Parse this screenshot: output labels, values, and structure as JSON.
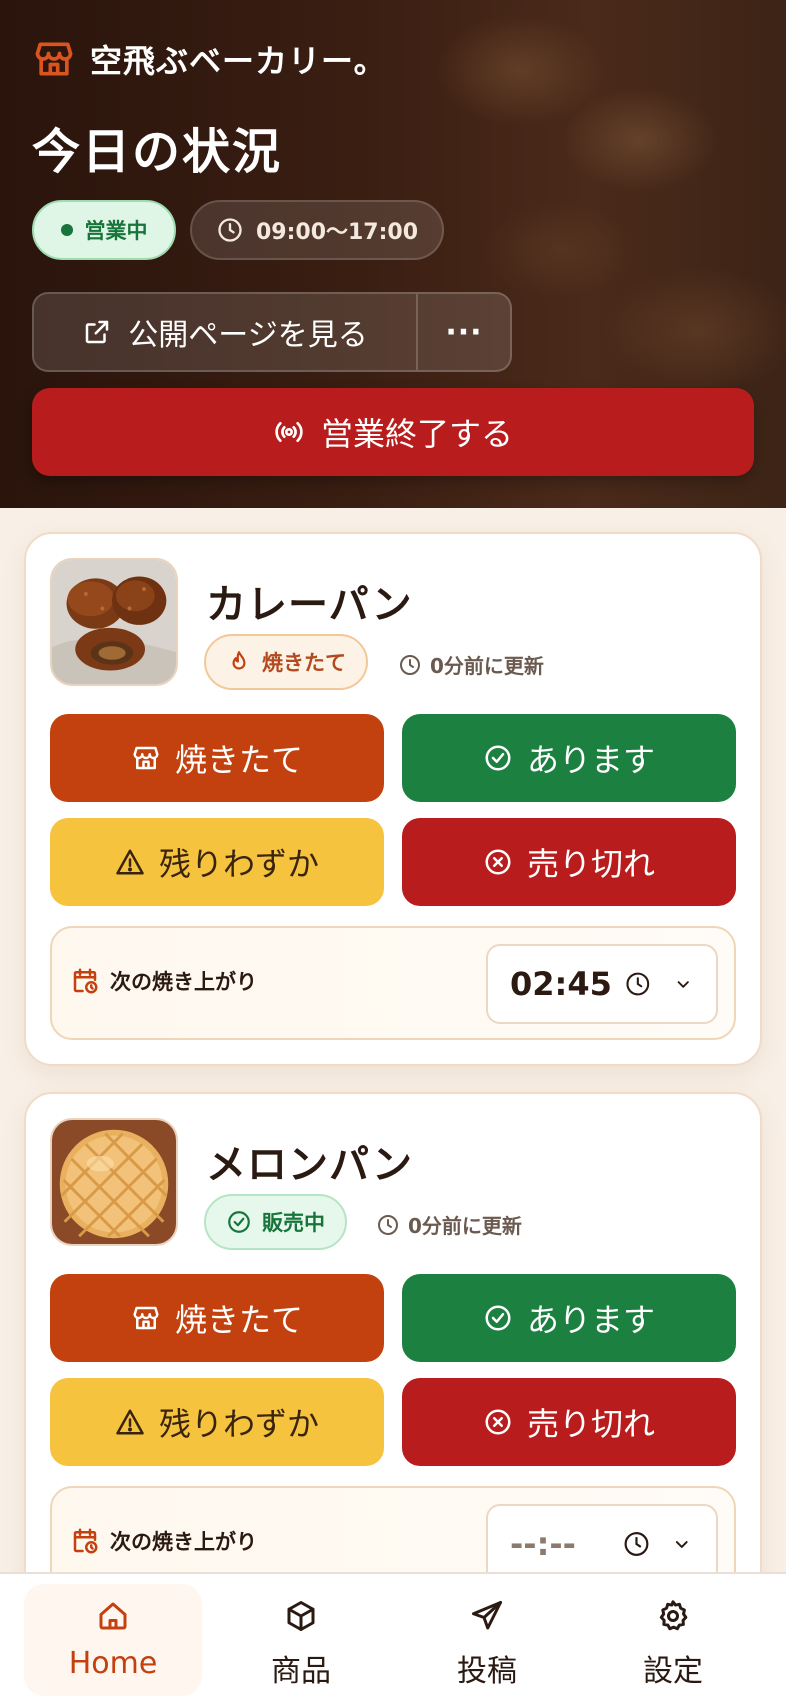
{
  "header": {
    "brand_name": "空飛ぶベーカリー。",
    "title": "今日の状況",
    "status_label": "営業中",
    "hours": "09:00〜17:00",
    "public_page_label": "公開ページを見る",
    "more_label": "···",
    "close_business_label": "営業終了する"
  },
  "products": [
    {
      "name": "カレーパン",
      "badge": "焼きたて",
      "updated": "0分前に更新",
      "buttons": [
        "焼きたて",
        "あります",
        "残りわずか",
        "売り切れ"
      ],
      "next_label": "次の焼き上がり",
      "next_time": "02:45"
    },
    {
      "name": "メロンパン",
      "badge": "販売中",
      "updated": "0分前に更新",
      "buttons": [
        "焼きたて",
        "あります",
        "残りわずか",
        "売り切れ"
      ],
      "next_label": "次の焼き上がり",
      "next_time": "--:--"
    }
  ],
  "nav": [
    {
      "label": "Home",
      "icon": "home-icon",
      "active": true
    },
    {
      "label": "商品",
      "icon": "box-icon",
      "active": false
    },
    {
      "label": "投稿",
      "icon": "send-icon",
      "active": false
    },
    {
      "label": "設定",
      "icon": "gear-icon",
      "active": false
    }
  ],
  "colors": {
    "accent": "#c2410f",
    "green": "#1c8040",
    "yellow": "#f5c33e",
    "red": "#b81c1c",
    "hero_bg": "#2a140c"
  }
}
